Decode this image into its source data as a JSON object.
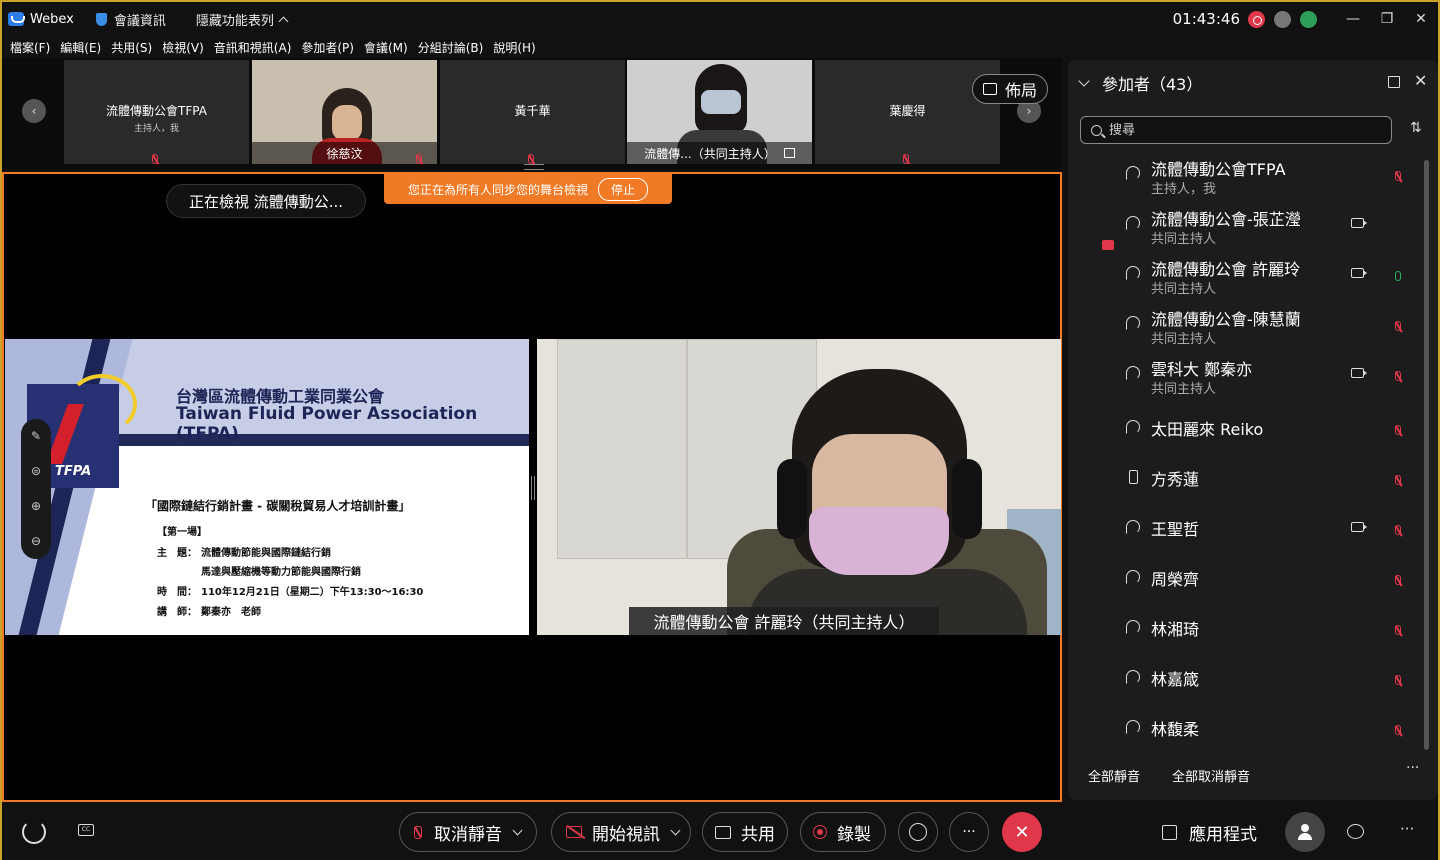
{
  "titlebar": {
    "app_name": "Webex",
    "meeting_info": "會議資訊",
    "hide_features": "隱藏功能表列",
    "clock": "01:43:46"
  },
  "menu": [
    "檔案(F)",
    "編輯(E)",
    "共用(S)",
    "檢視(V)",
    "音訊和視訊(A)",
    "參加者(P)",
    "會議(M)",
    "分組討論(B)",
    "說明(H)"
  ],
  "filmstrip": {
    "tiles": [
      {
        "name": "流體傳動公會TFPA",
        "sub": "主持人，我",
        "video": false
      },
      {
        "name": "徐慈汶",
        "video": true
      },
      {
        "name": "黃千華",
        "video": false
      },
      {
        "name": "流體傳...（共同主持人）",
        "video": true
      },
      {
        "name": "葉慶得",
        "video": false
      }
    ],
    "layout_label": "佈局"
  },
  "stage": {
    "viewing_label": "正在檢視 流體傳動公...",
    "sync_banner": "您正在為所有人同步您的舞台檢視",
    "stop_label": "停止",
    "slide": {
      "title_zh": "台灣區流體傳動工業同業公會",
      "title_en": "Taiwan Fluid Power Association (TFPA)",
      "logo_text": "TFPA",
      "heading": "「國際鏈結行銷計畫 - 碳關稅貿易人才培訓計畫」",
      "session": "【第一場】",
      "topic_label": "主　題：",
      "topic_line1": "流體傳動節能與國際鏈結行銷",
      "topic_line2": "馬達與壓縮機等動力節能與國際行銷",
      "time_label": "時　間：",
      "time_value": "110年12月21日（星期二）下午13:30～16:30",
      "speaker_label": "講　師：",
      "speaker_value": "鄭秦亦　老師"
    },
    "video_name": "流體傳動公會 許麗玲（共同主持人）"
  },
  "participants": {
    "title": "參加者（43）",
    "search_placeholder": "搜尋",
    "list": [
      {
        "name": "流體傳動公會TFPA",
        "role": "主持人，我",
        "device": "audio",
        "camera": false,
        "mic": "muted"
      },
      {
        "name": "流體傳動公會-張芷瀅",
        "role": "共同主持人",
        "device": "audio",
        "camera": true,
        "mic": "none",
        "sharing": true
      },
      {
        "name": "流體傳動公會 許麗玲",
        "role": "共同主持人",
        "device": "audio",
        "camera": true,
        "mic": "on"
      },
      {
        "name": "流體傳動公會-陳慧蘭",
        "role": "共同主持人",
        "device": "audio",
        "camera": false,
        "mic": "muted"
      },
      {
        "name": "雲科大 鄭秦亦",
        "role": "共同主持人",
        "device": "audio",
        "camera": true,
        "mic": "muted"
      },
      {
        "name": "太田麗來 Reiko",
        "role": "",
        "device": "audio",
        "camera": false,
        "mic": "muted"
      },
      {
        "name": "方秀蓮",
        "role": "",
        "device": "phone",
        "camera": false,
        "mic": "muted"
      },
      {
        "name": "王聖哲",
        "role": "",
        "device": "audio",
        "camera": true,
        "mic": "muted"
      },
      {
        "name": "周榮齊",
        "role": "",
        "device": "audio",
        "camera": false,
        "mic": "muted"
      },
      {
        "name": "林湘琦",
        "role": "",
        "device": "audio",
        "camera": false,
        "mic": "muted"
      },
      {
        "name": "林嘉箴",
        "role": "",
        "device": "audio",
        "camera": false,
        "mic": "muted"
      },
      {
        "name": "林馥柔",
        "role": "",
        "device": "audio",
        "camera": false,
        "mic": "muted"
      }
    ],
    "mute_all": "全部靜音",
    "unmute_all": "全部取消靜音"
  },
  "bottombar": {
    "unmute": "取消靜音",
    "start_video": "開始視訊",
    "share": "共用",
    "record": "錄製",
    "apps": "應用程式"
  },
  "colors": {
    "accent_orange": "#f07a26",
    "end_red": "#e0374a",
    "window_border": "#c9a227"
  }
}
